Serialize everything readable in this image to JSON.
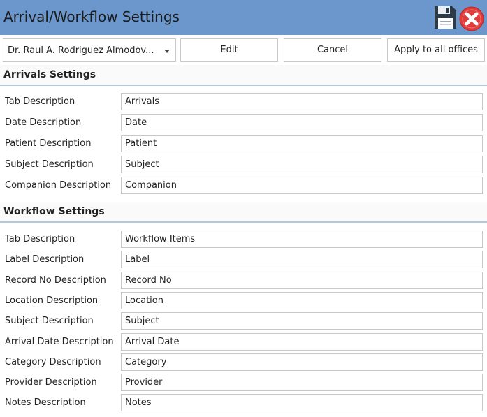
{
  "window": {
    "title": "Arrival/Workflow Settings"
  },
  "icons": {
    "save": "floppy-disk-icon",
    "close": "red-circle-x-icon"
  },
  "colors": {
    "titlebar": "#6b97cd",
    "close_red": "#e23b3b",
    "section_border": "#b4c8dc"
  },
  "toolbar": {
    "provider_selected": "Dr. Raul A. Rodriguez Almodov...",
    "edit_label": "Edit",
    "cancel_label": "Cancel",
    "apply_label": "Apply to all offices"
  },
  "arrivals": {
    "title": "Arrivals Settings",
    "rows": [
      {
        "label": "Tab Description",
        "value": "Arrivals"
      },
      {
        "label": "Date Description",
        "value": "Date"
      },
      {
        "label": "Patient Description",
        "value": "Patient"
      },
      {
        "label": "Subject Description",
        "value": "Subject"
      },
      {
        "label": "Companion Description",
        "value": "Companion"
      }
    ]
  },
  "workflow": {
    "title": "Workflow Settings",
    "rows": [
      {
        "label": "Tab Description",
        "value": "Workflow Items"
      },
      {
        "label": "Label Description",
        "value": "Label"
      },
      {
        "label": "Record No Description",
        "value": "Record No"
      },
      {
        "label": "Location Description",
        "value": "Location"
      },
      {
        "label": "Subject Description",
        "value": "Subject"
      },
      {
        "label": "Arrival Date Description",
        "value": "Arrival Date"
      },
      {
        "label": "Category Description",
        "value": "Category"
      },
      {
        "label": "Provider Description",
        "value": "Provider"
      },
      {
        "label": "Notes Description",
        "value": "Notes"
      }
    ]
  }
}
